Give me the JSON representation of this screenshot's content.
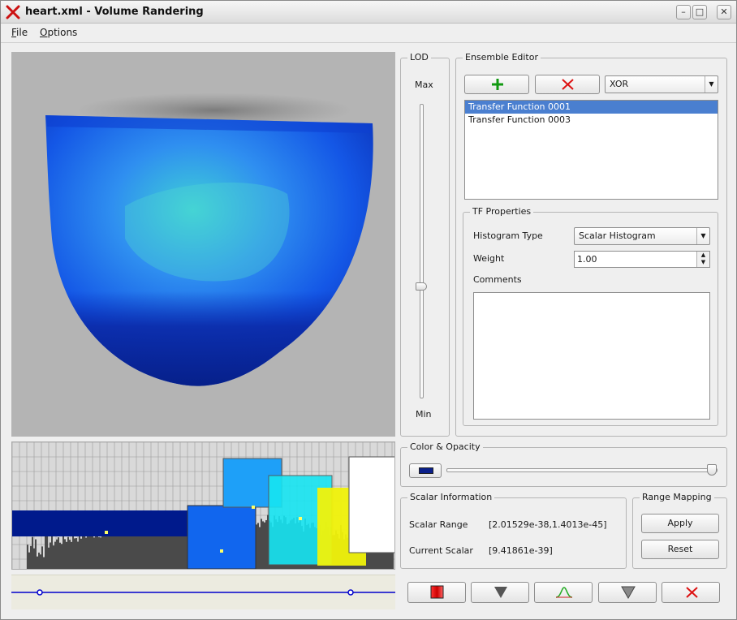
{
  "window": {
    "title": "heart.xml - Volume Randering"
  },
  "menu": [
    "File",
    "Options"
  ],
  "lod": {
    "title": "LOD",
    "max_label": "Max",
    "min_label": "Min",
    "level_fraction": 0.38
  },
  "ensemble": {
    "title": "Ensemble Editor",
    "mode": "XOR",
    "items": [
      "Transfer Function 0001",
      "Transfer Function 0003"
    ],
    "selected_index": 0
  },
  "tf_props": {
    "title": "TF Properties",
    "histogram_label": "Histogram Type",
    "histogram_value": "Scalar Histogram",
    "weight_label": "Weight",
    "weight_value": "1.00",
    "comments_label": "Comments"
  },
  "color_opacity": {
    "title": "Color & Opacity",
    "swatch": "#0a1f8a",
    "opacity_fraction": 0.98
  },
  "scalar": {
    "title": "Scalar Information",
    "range_label": "Scalar Range",
    "range_value": "[2.01529e-38,1.4013e-45]",
    "current_label": "Current Scalar",
    "current_value": "[9.41861e-39]"
  },
  "range_mapping": {
    "title": "Range Mapping",
    "apply": "Apply",
    "reset": "Reset"
  },
  "colors": {
    "selection": "#4a7fd0",
    "tf_line": "#0000cc"
  }
}
